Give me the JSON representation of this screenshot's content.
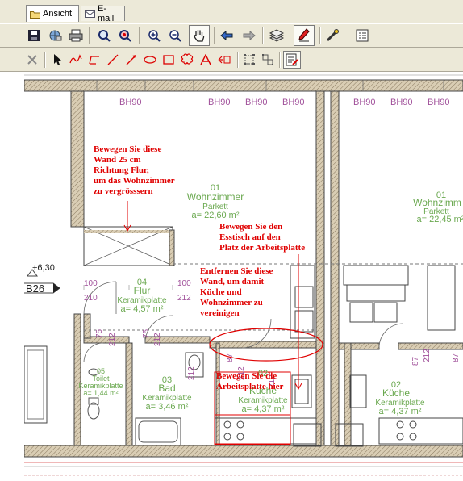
{
  "tabs": [
    {
      "label": "Ansicht",
      "icon": "folder-icon",
      "active": true
    },
    {
      "label": "E-mail",
      "icon": "envelope-icon",
      "active": false
    }
  ],
  "toolbar1": [
    {
      "name": "save-button",
      "icon": "floppy-disk-icon"
    },
    {
      "name": "network-button",
      "icon": "globe-icon"
    },
    {
      "name": "print-button",
      "icon": "printer-icon"
    },
    {
      "name": "zoom-find-button",
      "icon": "magnifier-icon"
    },
    {
      "name": "zoom-area-button",
      "icon": "magnifier-red-icon"
    },
    {
      "name": "zoom-in-button",
      "icon": "zoom-in-icon"
    },
    {
      "name": "zoom-out-button",
      "icon": "zoom-out-icon"
    },
    {
      "name": "pan-button",
      "icon": "hand-icon",
      "pressed": true
    },
    {
      "name": "back-button",
      "icon": "arrow-back-icon"
    },
    {
      "name": "forward-button",
      "icon": "arrow-forward-icon"
    },
    {
      "name": "layers-button",
      "icon": "layers-icon"
    },
    {
      "name": "annotate-button",
      "icon": "pen-icon",
      "pressed": true
    },
    {
      "name": "measure-button",
      "icon": "measure-icon"
    },
    {
      "name": "properties-button",
      "icon": "list-icon"
    }
  ],
  "toolbar2": [
    {
      "name": "delete-button",
      "icon": "x-icon"
    },
    {
      "name": "select-button",
      "icon": "cursor-icon"
    },
    {
      "name": "freehand-button",
      "icon": "freehand-icon"
    },
    {
      "name": "polyline-button",
      "icon": "polyline-icon"
    },
    {
      "name": "line-button",
      "icon": "line-icon"
    },
    {
      "name": "arrow-button",
      "icon": "arrow-icon"
    },
    {
      "name": "ellipse-button",
      "icon": "ellipse-icon"
    },
    {
      "name": "rectangle-button",
      "icon": "rectangle-icon"
    },
    {
      "name": "cloud-button",
      "icon": "cloud-icon"
    },
    {
      "name": "text-button",
      "icon": "text-A-icon"
    },
    {
      "name": "note-button",
      "icon": "note-icon"
    },
    {
      "name": "group-button",
      "icon": "group-icon"
    },
    {
      "name": "ungroup-button",
      "icon": "ungroup-icon"
    },
    {
      "name": "annotation-settings-button",
      "icon": "settings-icon",
      "pressed": true
    }
  ],
  "plan": {
    "bh_labels": [
      "BH90",
      "BH90",
      "BH90",
      "BH90",
      "BH90",
      "BH90",
      "BH90"
    ],
    "level_mark": "+6,30",
    "unit_label": "B26",
    "rooms": [
      {
        "num": "01",
        "name": "Wohnzimmer",
        "floor": "Parkett",
        "area": "a= 22,60 m²"
      },
      {
        "num": "01",
        "name": "Wohnzimm",
        "floor": "Parkett",
        "area": "a= 22,45 m²"
      },
      {
        "num": "04",
        "name": "Flur",
        "floor": "Keramikplatte",
        "area": "a= 4,57 m²"
      },
      {
        "num": "03",
        "name": "Bad",
        "floor": "Keramikplatte",
        "area": "a= 3,46 m²"
      },
      {
        "num": "05",
        "name": "Toilet",
        "floor": "Keramikplatte",
        "area": "a= 1,44 m²"
      },
      {
        "num": "02",
        "name": "Küche",
        "floor": "Keramikplatte",
        "area": "a= 4,37 m²"
      },
      {
        "num": "02",
        "name": "Küche",
        "floor": "Keramikplatte",
        "area": "a= 4,37 m²"
      }
    ],
    "dims": [
      "100",
      "210",
      "100",
      "212",
      "75",
      "212",
      "75",
      "212",
      "87",
      "212",
      "87",
      "212",
      "212",
      "87",
      "212"
    ]
  },
  "annotations": [
    "Bewegen Sie diese\nWand 25 cm\nRichtung Flur,\num das Wohnzimmer\nzu vergrösssern",
    "Bewegen Sie den\nEsstisch auf den\nPlatz der Arbeitsplatte",
    "Entfernen Sie diese\nWand, um damit\nKüche und\nWohnzimmer zu\nvereinigen",
    "Bewegen Sie die\nArbeitsplatte hier"
  ],
  "colors": {
    "annotation": "#e00000",
    "room_label": "#6aa84f",
    "bh_label": "#a0509a",
    "wall": "#c8b89a"
  }
}
